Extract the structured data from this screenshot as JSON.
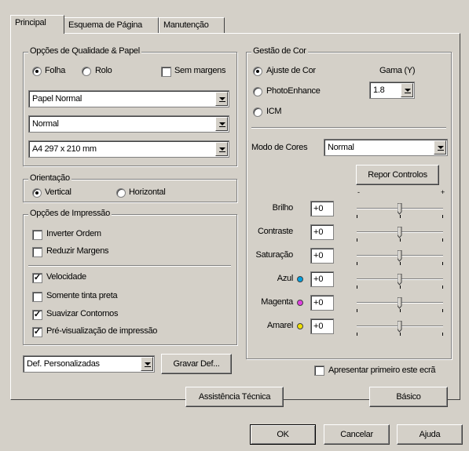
{
  "tabs": [
    {
      "label": "Principal"
    },
    {
      "label": "Esquema de Página"
    },
    {
      "label": "Manutenção"
    }
  ],
  "quality": {
    "title": "Opções de Qualidade & Papel",
    "folha": "Folha",
    "rolo": "Rolo",
    "sem_margens": "Sem margens",
    "paper_type": "Papel Normal",
    "quality_mode": "Normal",
    "paper_size": "A4 297 x 210 mm"
  },
  "orientation": {
    "title": "Orientação",
    "vertical": "Vertical",
    "horizontal": "Horizontal"
  },
  "print_options": {
    "title": "Opções de Impressão",
    "items": [
      {
        "label": "Inverter Ordem",
        "checked": false
      },
      {
        "label": "Reduzir Margens",
        "checked": false
      },
      {
        "label": "Velocidade",
        "checked": true
      },
      {
        "label": "Somente tinta preta",
        "checked": false
      },
      {
        "label": "Suavizar Contornos",
        "checked": true
      },
      {
        "label": "Pré-visualização de impressão",
        "checked": true
      }
    ]
  },
  "settings": {
    "value": "Def. Personalizadas",
    "save_label": "Gravar Def..."
  },
  "color": {
    "title": "Gestão de Cor",
    "ajuste": "Ajuste de Cor",
    "photoenhance": "PhotoEnhance",
    "icm": "ICM",
    "gama_label": "Gama (Y)",
    "gama_value": "1.8",
    "modo_label": "Modo de Cores",
    "modo_value": "Normal",
    "reset_label": "Repor Controlos",
    "sliders": [
      {
        "label": "Brilho",
        "value": "+0",
        "dot": ""
      },
      {
        "label": "Contraste",
        "value": "+0",
        "dot": ""
      },
      {
        "label": "Saturação",
        "value": "+0",
        "dot": ""
      },
      {
        "label": "Azul",
        "value": "+0",
        "dot": "#00a0e0"
      },
      {
        "label": "Magenta",
        "value": "+0",
        "dot": "#e040e0"
      },
      {
        "label": "Amarel",
        "value": "+0",
        "dot": "#f0e000"
      }
    ]
  },
  "show_first": "Apresentar primeiro este ecrã",
  "buttons": {
    "assist": "Assistência Técnica",
    "basico": "Básico",
    "ok": "OK",
    "cancel": "Cancelar",
    "help": "Ajuda"
  }
}
